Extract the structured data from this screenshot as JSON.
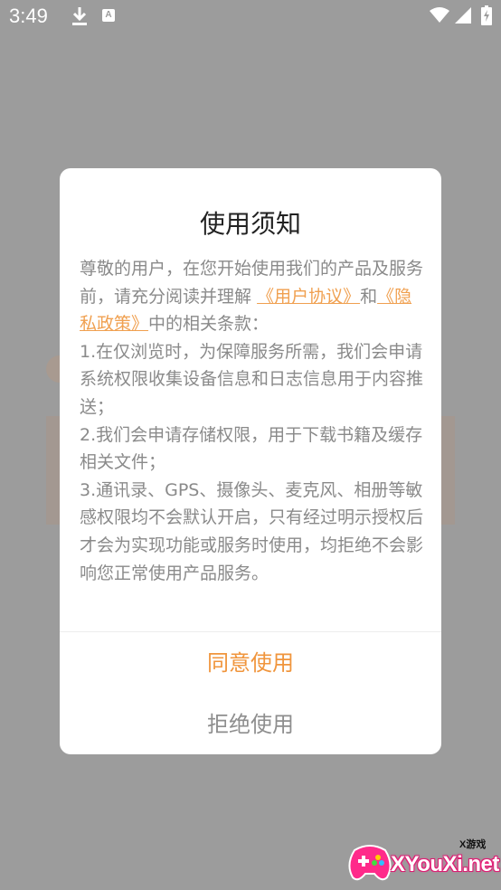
{
  "status_bar": {
    "time": "3:49",
    "icons": [
      "download-icon",
      "a-notification-icon",
      "wifi-icon",
      "signal-icon",
      "battery-icon"
    ],
    "a_icon_letter": "A"
  },
  "dialog": {
    "title": "使用须知",
    "body": {
      "p1_prefix": "尊敬的用户，在您开始使用我们的产品及服务前，请充分阅读并理解",
      "link_agreement": "《用户协议》",
      "p1_and": "和",
      "link_privacy": "《隐私政策》",
      "p1_suffix": "中的相关条款：",
      "item1": "1.在仅浏览时，为保障服务所需，我们会申请系统权限收集设备信息和日志信息用于内容推送；",
      "item2": "2.我们会申请存储权限，用于下载书籍及缓存相关文件；",
      "item3": "3.通讯录、GPS、摄像头、麦克风、相册等敏感权限均不会默认开启，只有经过明示授权后才会为实现功能或服务时使用，均拒绝不会影响您正常使用产品服务。"
    },
    "agree_label": "同意使用",
    "reject_label": "拒绝使用"
  },
  "watermark": {
    "small_text": "X游戏",
    "text": "XYouXi.net"
  },
  "colors": {
    "overlay": "#9c9c9c",
    "accent": "#f0953c",
    "body_text": "#8a8a8a",
    "title_text": "#222222"
  }
}
